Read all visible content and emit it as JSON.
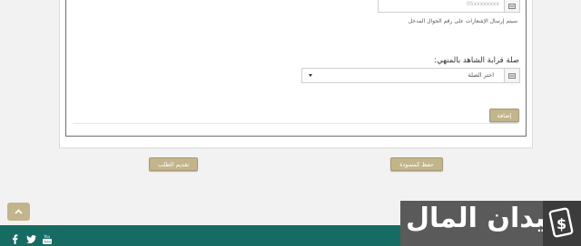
{
  "form": {
    "phone_placeholder": "05xxxxxxxx",
    "phone_hint": "سيتم إرسال الإشعارات على رقم الجوال المدخل",
    "relation_label": "صلة قرابة الشاهد بالمنهي:",
    "relation_select_value": "اختر الصلة",
    "add_button": "إضافة"
  },
  "actions": {
    "save_draft_button": "حفظ كمسودة",
    "submit_button": "تقديم الطلب"
  },
  "footer": {
    "brand_name": "ميدان المال",
    "social_icons": [
      "facebook-icon",
      "twitter-icon",
      "youtube-icon"
    ]
  },
  "colors": {
    "accent_button": "#c2b48b",
    "footer_green": "#166c63",
    "logo_bg": "#5a5a5a"
  }
}
